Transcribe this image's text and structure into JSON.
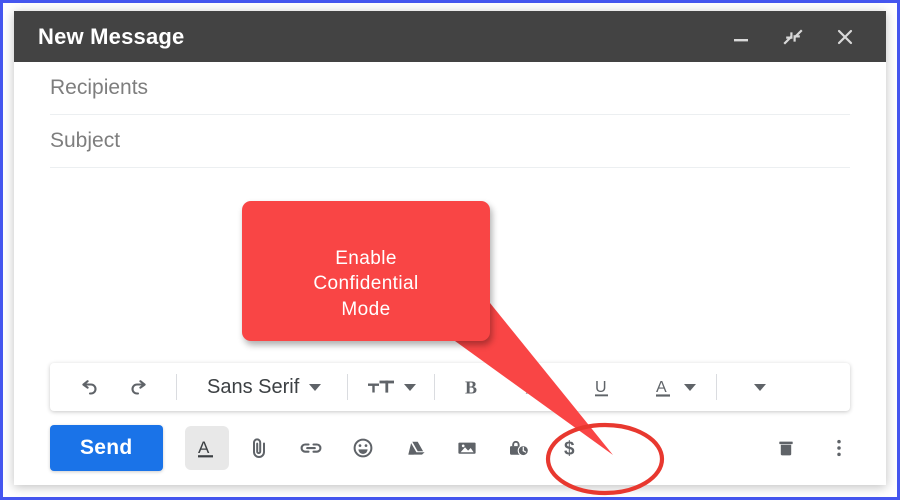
{
  "window": {
    "title": "New Message",
    "controls": [
      {
        "name": "minimize-button",
        "icon": "minimize-icon",
        "label": "Minimize"
      },
      {
        "name": "exit-fullscreen-button",
        "icon": "exit-fullscreen-icon",
        "label": "Exit full screen"
      },
      {
        "name": "close-button",
        "icon": "close-icon",
        "label": "Close"
      }
    ]
  },
  "fields": {
    "recipients_placeholder": "Recipients",
    "subject_placeholder": "Subject",
    "recipients_value": "",
    "subject_value": "",
    "body_value": ""
  },
  "format_toolbar": {
    "undo_label": "Undo",
    "redo_label": "Redo",
    "font_name": "Sans Serif",
    "font_caret": "▾",
    "size_label": "Size",
    "bold_label": "Bold",
    "italic_label": "Italic",
    "underline_label": "Underline",
    "text_color_label": "Text color",
    "more_format_label": "More formatting options"
  },
  "actions": {
    "send_label": "Send",
    "formatting_label": "Formatting options",
    "attach_label": "Attach files",
    "link_label": "Insert link",
    "emoji_label": "Insert emoji",
    "drive_label": "Insert files using Drive",
    "photo_label": "Insert photo",
    "confidential_label": "Toggle confidential mode",
    "money_label": "Insert money",
    "discard_label": "Discard draft",
    "more_label": "More options"
  },
  "callout": {
    "line1": "Enable",
    "line2": "Confidential",
    "line3": "Mode",
    "color": "#f94545",
    "highlight_color": "#e8382f"
  },
  "colors": {
    "header_bg": "#434343",
    "frame_border": "#4556ef",
    "send_blue": "#1a73e8",
    "icon_gray": "#5f6368",
    "placeholder_gray": "#7e7e7e"
  }
}
